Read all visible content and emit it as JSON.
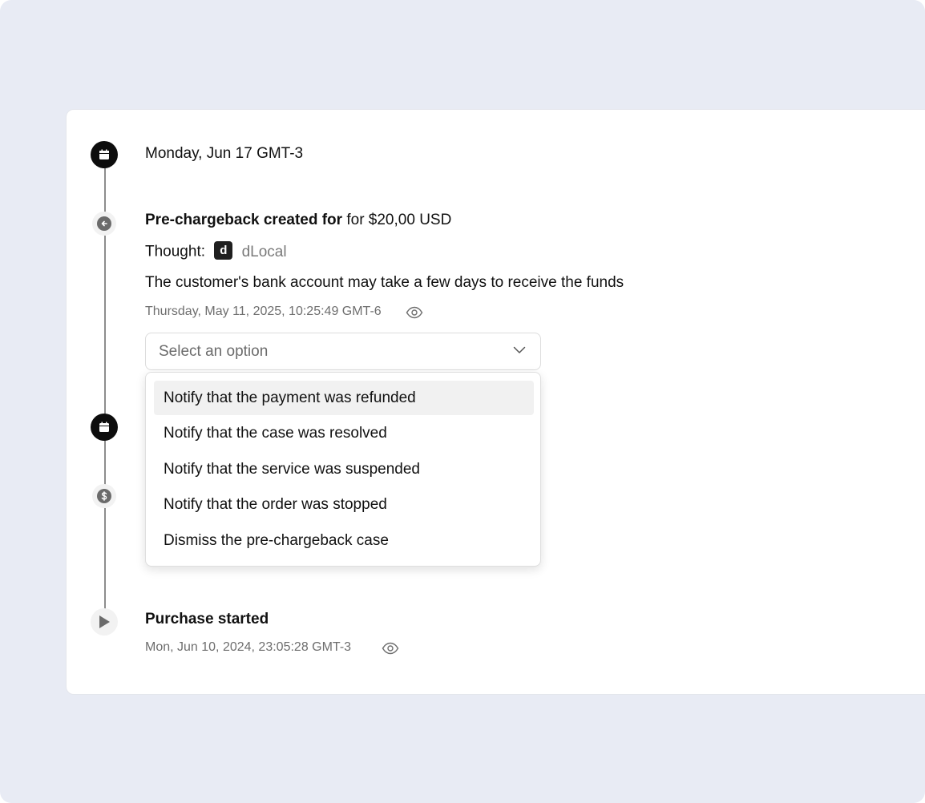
{
  "timeline": {
    "date_header_1": "Monday, Jun 17 GMT-3",
    "event_1": {
      "title_bold": "Pre-chargeback created for",
      "title_rest": "for $20,00 USD",
      "thought_label": "Thought:",
      "thought_badge": "d",
      "thought_source": "dLocal",
      "message": "The customer's bank account may take a few days to receive the funds",
      "timestamp": "Thursday, May 11, 2025, 10:25:49 GMT-6",
      "icon": "arrow-left-icon"
    },
    "select": {
      "placeholder": "Select an option",
      "options": [
        "Notify that the payment was refunded",
        "Notify that the case was resolved",
        "Notify that the service was suspended",
        "Notify that the order was stopped",
        "Dismiss the pre-chargeback case"
      ]
    },
    "event_last": {
      "title": "Purchase started",
      "timestamp": "Mon, Jun 10, 2024, 23:05:28 GMT-3",
      "icon": "play-icon"
    }
  },
  "colors": {
    "background": "#e8ebf4",
    "node_dark": "#0d0d0d",
    "muted_text": "#6e6e6e"
  }
}
